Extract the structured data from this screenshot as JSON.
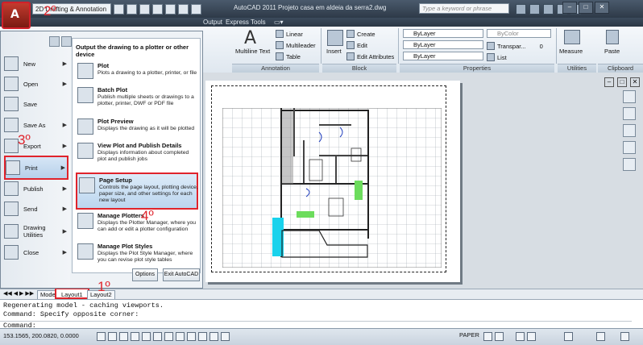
{
  "titlebar": {
    "workspace": "2D Drafting & Annotation",
    "title": "AutoCAD 2011   Projeto casa em aldeia da serra2.dwg",
    "search_placeholder": "Type a keyword or phrase"
  },
  "tabs": [
    "Output",
    "Express Tools"
  ],
  "ribbon": {
    "annotation": {
      "multiline_text": "Multiline Text",
      "linear": "Linear",
      "multileader": "Multileader",
      "table": "Table",
      "panel": "Annotation"
    },
    "block": {
      "insert": "Insert",
      "create": "Create",
      "edit": "Edit",
      "edit_attributes": "Edit Attributes",
      "panel": "Block"
    },
    "properties": {
      "color": "ByLayer",
      "linetype": "ByLayer",
      "lineweight": "ByLayer",
      "bycolor": "ByColor",
      "transparency": "Transpar...",
      "transparency_value": "0",
      "list": "List",
      "panel": "Properties"
    },
    "utilities": {
      "measure": "Measure",
      "panel": "Utilities"
    },
    "clipboard": {
      "paste": "Paste",
      "panel": "Clipboard"
    }
  },
  "app_menu": {
    "items": [
      "New",
      "Open",
      "Save",
      "Save As",
      "Export",
      "Print",
      "Publish",
      "Send",
      "Drawing Utilities",
      "Close"
    ],
    "submenu_heading": "Output the drawing to a plotter or other device",
    "submenu": [
      {
        "title": "Plot",
        "desc": "Plots a drawing to a plotter, printer, or file"
      },
      {
        "title": "Batch Plot",
        "desc": "Publish multiple sheets or drawings to a plotter, printer, DWF or PDF file"
      },
      {
        "title": "Plot Preview",
        "desc": "Displays the drawing as it will be plotted"
      },
      {
        "title": "View Plot and Publish Details",
        "desc": "Displays information about completed plot and publish jobs"
      },
      {
        "title": "Page Setup",
        "desc": "Controls the page layout, plotting device, paper size, and other settings for each new layout"
      },
      {
        "title": "Manage Plotters",
        "desc": "Displays the Plotter Manager, where you can add or edit a plotter configuration"
      },
      {
        "title": "Manage Plot Styles",
        "desc": "Displays the Plot Style Manager, where you can revise plot style tables"
      }
    ],
    "options": "Options",
    "exit": "Exit AutoCAD"
  },
  "annotations": {
    "a1": "1º",
    "a2": "2º",
    "a3": "3º",
    "a4": "4º"
  },
  "layout_tabs": [
    "Model",
    "Layout1",
    "Layout2"
  ],
  "command_line": {
    "line1": "Regenerating model - caching viewports.",
    "line2": "Command: Specify opposite corner:",
    "prompt": "Command:"
  },
  "status": {
    "coords": "153.1565, 200.0820, 0.0000",
    "paper": "PAPER"
  },
  "colors": {
    "accent": "#e0242c",
    "selection": "#bcd6ef"
  }
}
